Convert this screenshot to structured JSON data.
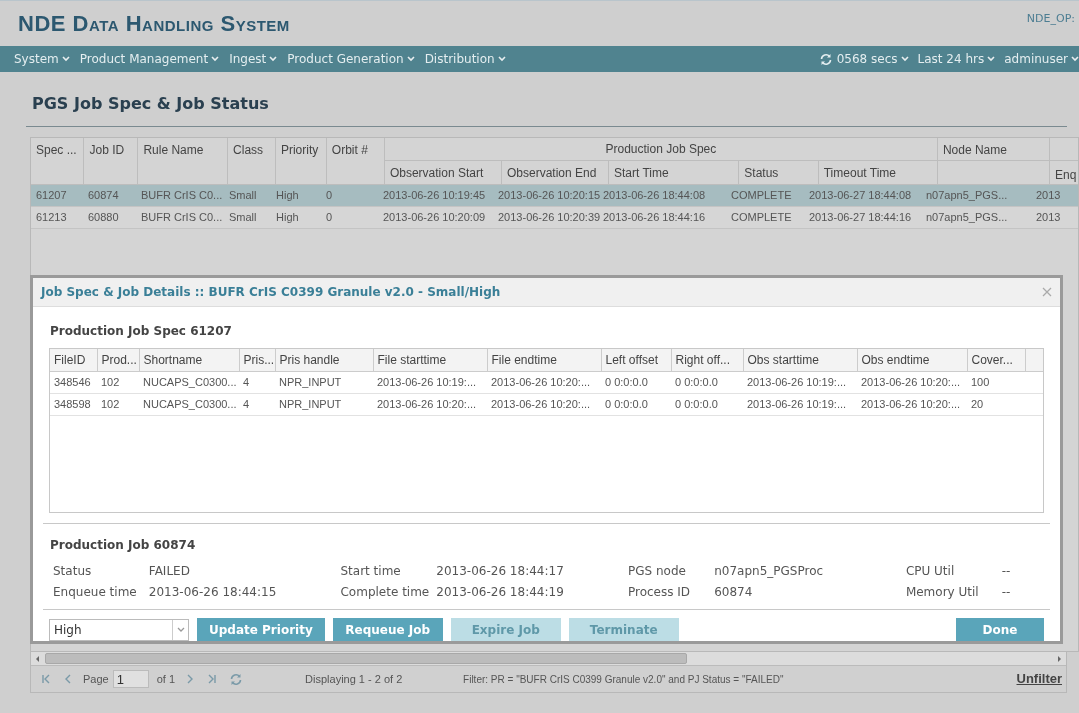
{
  "app": {
    "title": "NDE Data Handling System",
    "instance": "NDE_OP:"
  },
  "menu": [
    {
      "label": "System"
    },
    {
      "label": "Product Management"
    },
    {
      "label": "Ingest"
    },
    {
      "label": "Product Generation"
    },
    {
      "label": "Distribution"
    }
  ],
  "status_menu": [
    {
      "label": "0568 secs",
      "kind": "refresh"
    },
    {
      "label": "Last 24 hrs",
      "kind": "plain"
    },
    {
      "label": "adminuser",
      "kind": "plain"
    }
  ],
  "page_title": "PGS Job Spec & Job Status",
  "grid": {
    "columns": [
      "Spec ...",
      "Job ID",
      "Rule Name",
      "Class",
      "Priority",
      "Orbit #"
    ],
    "group_header": "Production Job Spec",
    "group_columns": [
      "Observation Start",
      "Observation End",
      "Start Time",
      "Status",
      "Timeout Time"
    ],
    "trailing_columns": [
      "Node Name",
      "Enq"
    ],
    "rows": [
      {
        "selected": true,
        "cells": [
          "61207",
          "60874",
          "BUFR CrIS C0...",
          "Small",
          "High",
          "0",
          "2013-06-26 10:19:45",
          "2013-06-26 10:20:15",
          "2013-06-26 18:44:08",
          "COMPLETE",
          "2013-06-27 18:44:08",
          "n07apn5_PGS...",
          "2013"
        ]
      },
      {
        "selected": false,
        "cells": [
          "61213",
          "60880",
          "BUFR CrIS C0...",
          "Small",
          "High",
          "0",
          "2013-06-26 10:20:09",
          "2013-06-26 10:20:39",
          "2013-06-26 18:44:16",
          "COMPLETE",
          "2013-06-27 18:44:16",
          "n07apn5_PGS...",
          "2013"
        ]
      }
    ]
  },
  "dialog": {
    "title": "Job Spec & Job Details :: BUFR CrIS C0399 Granule v2.0 - Small/High",
    "spec_title": "Production Job Spec 61207",
    "spec_columns": [
      "FileID",
      "Prod...",
      "Shortname",
      "Pris...",
      "Pris handle",
      "File starttime",
      "File endtime",
      "Left offset",
      "Right off...",
      "Obs starttime",
      "Obs endtime",
      "Cover..."
    ],
    "spec_rows": [
      [
        "348546",
        "102",
        "NUCAPS_C0300...",
        "4",
        "NPR_INPUT",
        "2013-06-26 10:19:...",
        "2013-06-26 10:20:...",
        "0 0:0:0.0",
        "0 0:0:0.0",
        "2013-06-26 10:19:...",
        "2013-06-26 10:20:...",
        "100"
      ],
      [
        "348598",
        "102",
        "NUCAPS_C0300...",
        "4",
        "NPR_INPUT",
        "2013-06-26 10:20:...",
        "2013-06-26 10:20:...",
        "0 0:0:0.0",
        "0 0:0:0.0",
        "2013-06-26 10:19:...",
        "2013-06-26 10:20:...",
        "20"
      ]
    ],
    "job_title": "Production Job 60874",
    "job_fields": [
      [
        {
          "label": "Status",
          "value": "FAILED"
        },
        {
          "label": "Start time",
          "value": "2013-06-26 18:44:17"
        },
        {
          "label": "PGS node",
          "value": "n07apn5_PGSProc"
        },
        {
          "label": "CPU Util",
          "value": "--"
        }
      ],
      [
        {
          "label": "Enqueue time",
          "value": "2013-06-26 18:44:15"
        },
        {
          "label": "Complete time",
          "value": "2013-06-26 18:44:19"
        },
        {
          "label": "Process ID",
          "value": "60874"
        },
        {
          "label": "Memory Util",
          "value": "--"
        }
      ]
    ],
    "priority_select": "High",
    "buttons": [
      {
        "label": "Update Priority",
        "disabled": false
      },
      {
        "label": "Requeue Job",
        "disabled": false
      },
      {
        "label": "Expire Job",
        "disabled": true
      },
      {
        "label": "Terminate",
        "disabled": true
      }
    ],
    "done_button": "Done"
  },
  "pager": {
    "page_label": "Page",
    "page": "1",
    "of": "of 1",
    "displaying": "Displaying 1 - 2 of 2",
    "filter": "Filter: PR = \"BUFR CrIS C0399 Granule v2.0\" and PJ Status = \"FAILED\"",
    "unfilter": "Unfilter"
  }
}
